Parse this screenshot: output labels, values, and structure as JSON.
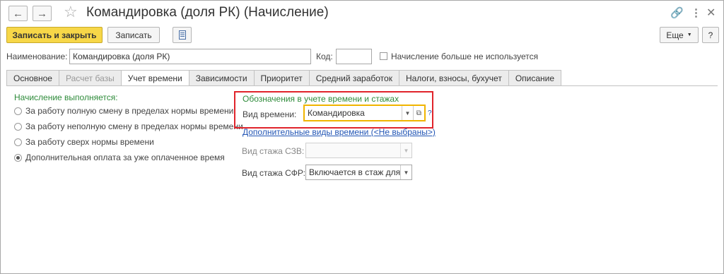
{
  "window": {
    "title": "Командировка (доля РК) (Начисление)",
    "icons": [
      "arrow-left-icon",
      "arrow-right-icon",
      "star-icon",
      "link-icon",
      "more-vertical-icon",
      "close-icon"
    ]
  },
  "toolbar": {
    "save_close_label": "Записать и закрыть",
    "save_label": "Записать",
    "report_icon": "document-icon",
    "more_label": "Еще",
    "help_label": "?"
  },
  "header": {
    "name_label": "Наименование:",
    "name_value": "Командировка (доля РК)",
    "code_label": "Код:",
    "code_value": "",
    "unused_label": "Начисление больше не используется",
    "unused_checked": false
  },
  "tabs": [
    {
      "label": "Основное",
      "state": "normal"
    },
    {
      "label": "Расчет базы",
      "state": "disabled"
    },
    {
      "label": "Учет времени",
      "state": "active"
    },
    {
      "label": "Зависимости",
      "state": "normal"
    },
    {
      "label": "Приоритет",
      "state": "normal"
    },
    {
      "label": "Средний заработок",
      "state": "normal"
    },
    {
      "label": "Налоги, взносы, бухучет",
      "state": "normal"
    },
    {
      "label": "Описание",
      "state": "normal"
    }
  ],
  "left": {
    "heading": "Начисление выполняется:",
    "options": [
      {
        "label": "За работу полную смену в пределах нормы времени",
        "selected": false
      },
      {
        "label": "За работу неполную смену в пределах нормы времени",
        "selected": false
      },
      {
        "label": "За работу сверх нормы времени",
        "selected": false
      },
      {
        "label": "Дополнительная оплата за уже оплаченное время",
        "selected": true
      }
    ]
  },
  "right": {
    "heading": "Обозначения в учете времени и стажах",
    "time_kind_label": "Вид времени:",
    "time_kind_value": "Командировка",
    "question": "?",
    "extra_link": "Дополнительные виды времени (<Не выбраны>)",
    "szv_label": "Вид стажа СЗВ:",
    "szv_value": "",
    "sfr_label": "Вид стажа СФР:",
    "sfr_value": "Включается в стаж для..."
  },
  "colors": {
    "accent_yellow": "#f7d748",
    "highlight_red": "#e0242b",
    "heading_green": "#2e8b3a",
    "link_blue": "#2356b5",
    "focus_orange": "#f0b400"
  }
}
